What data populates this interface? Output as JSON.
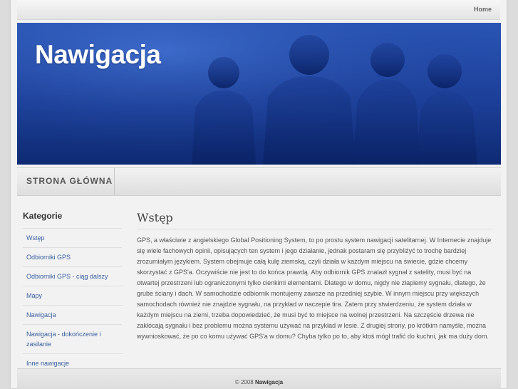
{
  "header": {
    "home_link": "Home"
  },
  "banner": {
    "title": "Nawigacja"
  },
  "nav": {
    "items": [
      {
        "label": "STRONA GŁÓWNA"
      }
    ]
  },
  "sidebar": {
    "title": "Kategorie",
    "items": [
      {
        "label": "Wstęp"
      },
      {
        "label": "Odbiorniki GPS"
      },
      {
        "label": "Odbiorniki GPS - ciąg dalszy"
      },
      {
        "label": "Mapy"
      },
      {
        "label": "Nawigacja"
      },
      {
        "label": "Nawigacja - dokończenie i zasilanie"
      },
      {
        "label": "Inne nawigacje"
      }
    ]
  },
  "content": {
    "title": "Wstęp",
    "text": "GPS, a właściwie z angielskiego Global Positioning System, to po prostu system nawigacji satelitarnej. W Internecie znajduje się wiele fachowych opinii, opisujących ten system i jego działanie, jednak postaram się przybliżyć to trochę bardziej zrozumiałym językiem. System obejmuje całą kulę ziemską, czyli działa w każdym miejscu na świecie, gdzie chcemy skorzystać z GPS'a. Oczywiście nie jest to do końca prawdą. Aby odbiornik GPS znalazł sygnał z satelity, musi być na otwartej przestrzeni lub ograniczonymi tylko cienkimi elementami. Dlatego w domu, nigdy nie złapiemy sygnału, dlatego, że grube ściany i dach. W samochodzie odbiornik montujemy zawsze na przedniej szybie. W innym miejscu przy większych samochodach również nie znajdzie sygnału, na przykład w naczepie tira. Zatem przy stwierdzeniu, że system działa w każdym miejscu na ziemi, trzeba dopowiedzieć, że musi być to miejsce na wolnej przestrzeni. Na szczęście drzewa nie zakłócają sygnału i bez problemu można systemu używać na przykład w lesie. Z drugiej strony, po krótkim namyśle, można wywnioskować, że po co komu używać GPS'a w domu? Chyba tylko po to, aby ktoś mógł trafić do kuchni, jak ma duży dom."
  },
  "footer": {
    "copyright": "© 2008",
    "site_name": "Nawigacja"
  },
  "colors": {
    "banner_blue": "#1c3f98",
    "link_blue": "#3a5fa0"
  }
}
